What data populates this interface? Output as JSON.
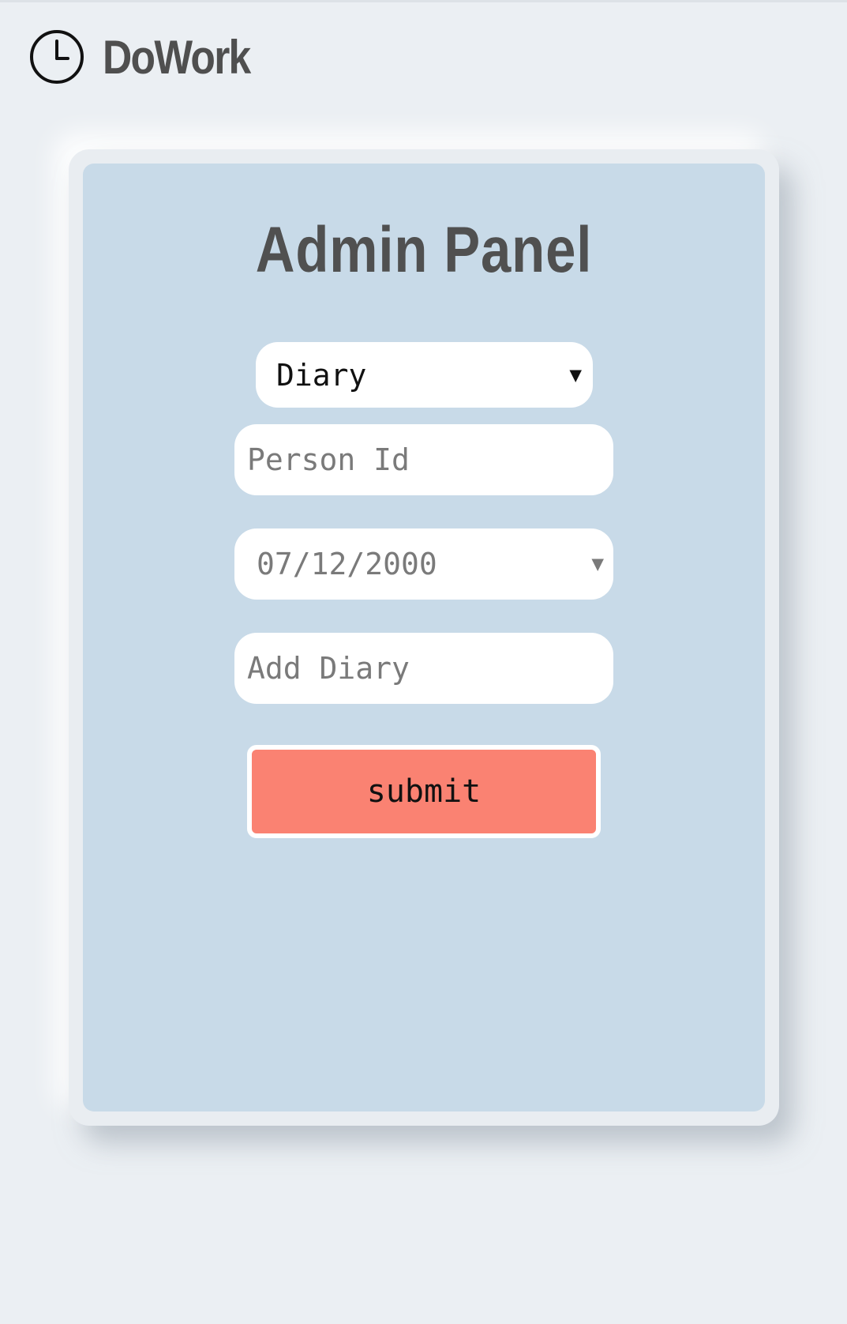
{
  "header": {
    "brand_name": "DoWork",
    "brand_icon": "clock-icon"
  },
  "panel": {
    "title": "Admin Panel",
    "type_select": {
      "selected": "Diary",
      "arrow_icon": "triangle-down-icon"
    },
    "person_id": {
      "placeholder": "Person Id",
      "value": ""
    },
    "date": {
      "value": "07/12/2000",
      "arrow_icon": "triangle-down-icon"
    },
    "diary": {
      "placeholder": "Add Diary",
      "value": ""
    },
    "submit_label": "submit"
  },
  "colors": {
    "page_background": "#ebeff3",
    "card_background": "#c8dae8",
    "title_text": "#505050",
    "submit_button": "#fa8272",
    "field_background": "#ffffff"
  }
}
